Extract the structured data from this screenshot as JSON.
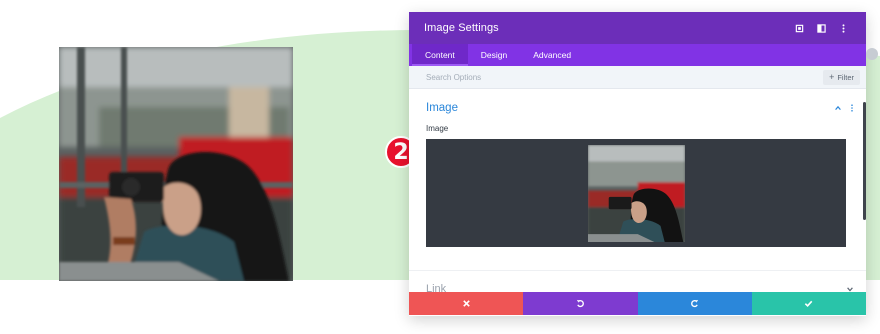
{
  "canvas": {
    "background_color": "#ffffff",
    "accent_shape_color": "#d6f0d3"
  },
  "step_marker": {
    "number": "2"
  },
  "panel": {
    "title": "Image Settings",
    "header_color": "#6c2eb9",
    "header_icons": [
      "expand-icon",
      "split-view-icon",
      "more-options-icon"
    ],
    "tabs": [
      {
        "label": "Content",
        "active": true
      },
      {
        "label": "Design",
        "active": false
      },
      {
        "label": "Advanced",
        "active": false
      }
    ],
    "search": {
      "placeholder": "Search Options",
      "value": ""
    },
    "filter": {
      "label": "Filter"
    },
    "section": {
      "title": "Image",
      "state": "expanded"
    },
    "field": {
      "label": "Image"
    },
    "next_section": {
      "title": "Link",
      "state": "collapsed"
    }
  },
  "actions": [
    {
      "name": "cancel",
      "icon": "close-icon",
      "color": "#ef5555"
    },
    {
      "name": "undo",
      "icon": "undo-icon",
      "color": "#7e3bd0"
    },
    {
      "name": "redo",
      "icon": "redo-icon",
      "color": "#2b87da"
    },
    {
      "name": "save",
      "icon": "check-icon",
      "color": "#29c4a9"
    }
  ]
}
